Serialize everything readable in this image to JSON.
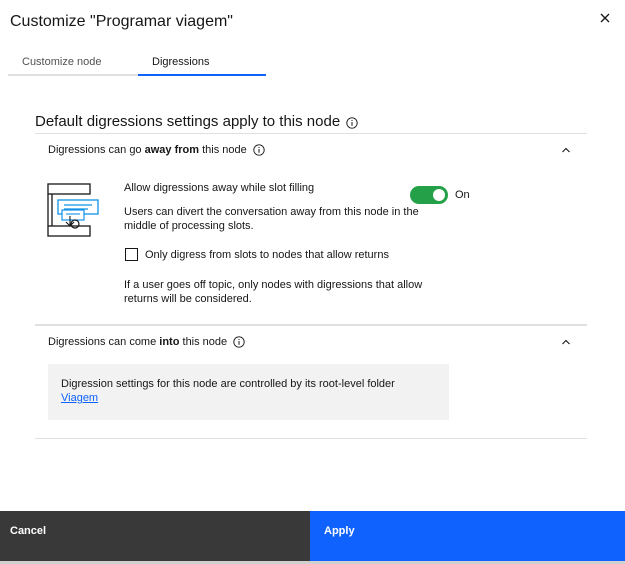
{
  "modal": {
    "title": "Customize \"Programar viagem\""
  },
  "tabs": [
    {
      "label": "Customize node",
      "active": false
    },
    {
      "label": "Digressions",
      "active": true
    }
  ],
  "section": {
    "heading": "Default digressions settings apply to this node"
  },
  "away": {
    "header_prefix": "Digressions can go ",
    "header_bold": "away from",
    "header_suffix": " this node",
    "slot_label": "Allow digressions away while slot filling",
    "toggle_state": "On",
    "toggle_on": true,
    "description": "Users can divert the conversation away from this node in the middle of processing slots.",
    "checkbox_label": "Only digress from slots to nodes that allow returns",
    "checkbox_checked": false,
    "note": "If a user goes off topic, only nodes with digressions that allow returns will be considered."
  },
  "into": {
    "header_prefix": "Digressions can come ",
    "header_bold": "into",
    "header_suffix": " this node",
    "info_text": "Digression settings for this node are controlled by its root-level folder",
    "link_text": "Viagem"
  },
  "footer": {
    "cancel_label": "Cancel",
    "apply_label": "Apply"
  },
  "colors": {
    "accent": "#0f62fe",
    "toggle_on": "#24a148",
    "cancel_bg": "#393939",
    "info_box_bg": "#f2f2f2"
  },
  "icons": {
    "close": "close-icon",
    "info": "info-icon",
    "chevron": "chevron-up-icon",
    "illustration": "digression-illustration"
  }
}
